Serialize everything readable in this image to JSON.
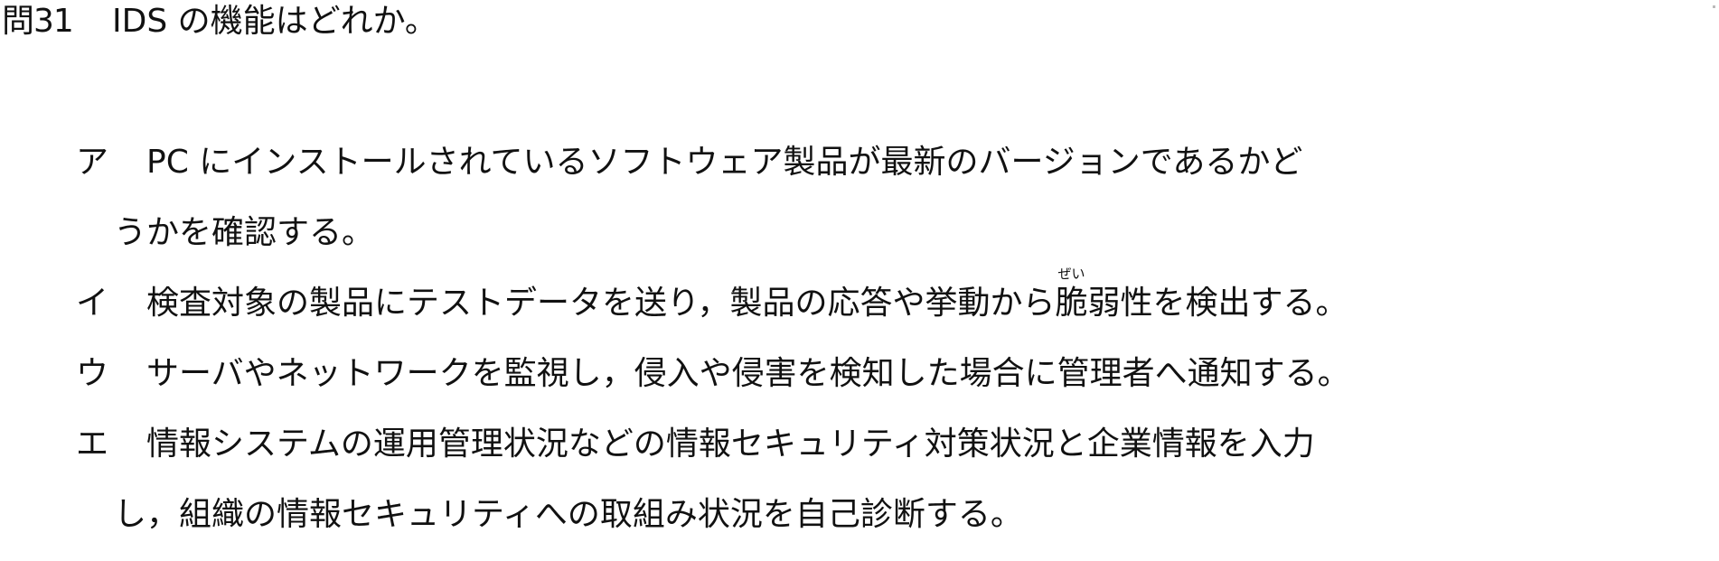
{
  "question": {
    "number": "問31",
    "text": "IDS の機能はどれか。"
  },
  "options": [
    {
      "marker": "ア",
      "line1": "PC にインストールされているソフトウェア製品が最新のバージョンであるかど",
      "line2": "うかを確認する。"
    },
    {
      "marker": "イ",
      "before_ruby": "検査対象の製品にテストデータを送り，製品の応答や挙動から",
      "ruby_base": "脆",
      "ruby_text": "ぜい",
      "after_ruby": "弱性を検出する。"
    },
    {
      "marker": "ウ",
      "line1": "サーバやネットワークを監視し，侵入や侵害を検知した場合に管理者へ通知する。"
    },
    {
      "marker": "エ",
      "line1": "情報システムの運用管理状況などの情報セキュリティ対策状況と企業情報を入力",
      "line2": "し，組織の情報セキュリティへの取組み状況を自己診断する。"
    }
  ]
}
